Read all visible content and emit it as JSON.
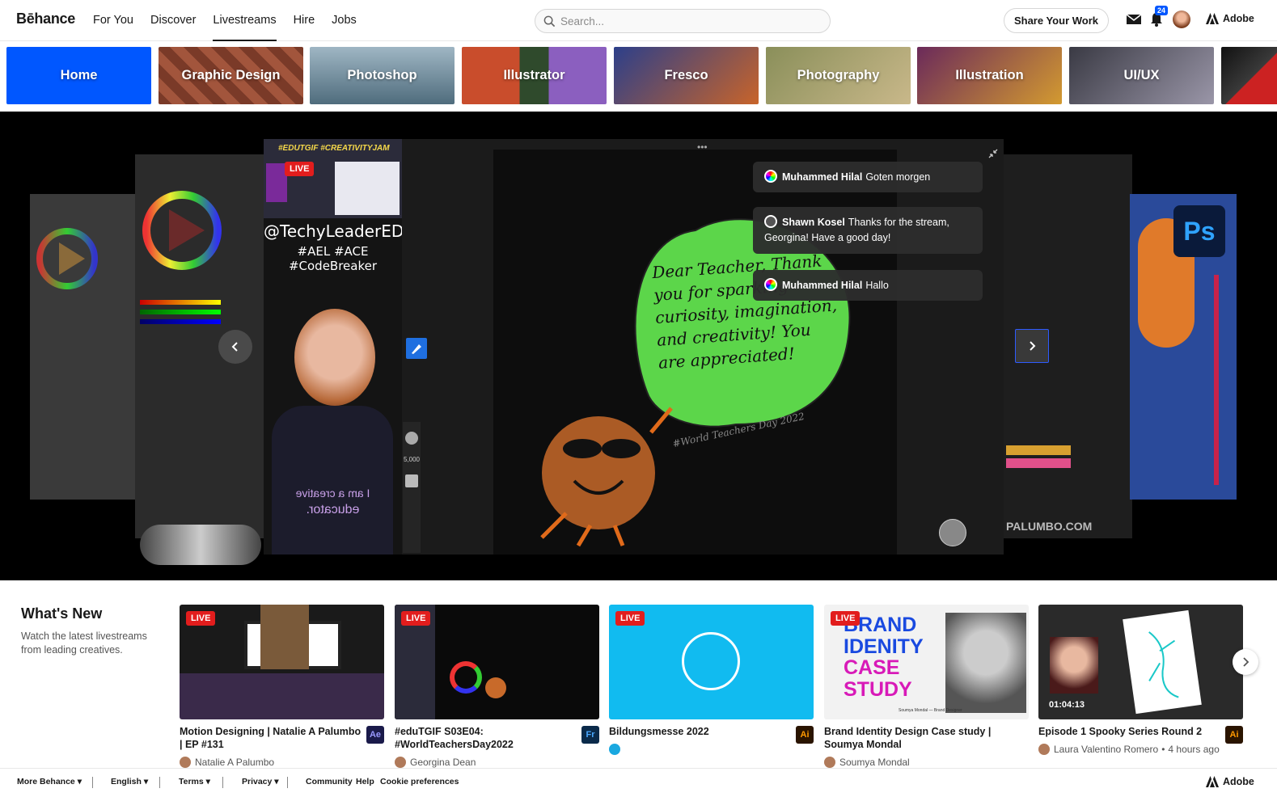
{
  "header": {
    "logo": "Bēhance",
    "nav": [
      "For You",
      "Discover",
      "Livestreams",
      "Hire",
      "Jobs"
    ],
    "active_nav": "Livestreams",
    "search_placeholder": "Search...",
    "share_label": "Share Your Work",
    "notification_count": "24",
    "adobe_label": "Adobe"
  },
  "categories": [
    "Home",
    "Graphic Design",
    "Photoshop",
    "Illustrator",
    "Fresco",
    "Photography",
    "Illustration",
    "UI/UX"
  ],
  "stream": {
    "live_label": "LIVE",
    "cam_hashtags_top": "#EDUTGIF #CREATIVITYJAM",
    "cam_handle": "@TechyLeaderEDU",
    "cam_tags": "#AEL #ACE #CodeBreaker",
    "cam_shirt_text_1": "I am a creative",
    "cam_shirt_text_2": "educator.",
    "canvas_text": "Dear Teacher, Thank you for sparking curiosity, imagination, and creativity! You are appreciated!",
    "canvas_hashtag": "#World Teachers Day 2022",
    "brush_size": "5,000",
    "side_right_text": "PALUMBO.COM",
    "ps_label": "Ps",
    "chat": [
      {
        "user": "Muhammed Hilal",
        "message": "Goten morgen"
      },
      {
        "user": "Shawn Kosel",
        "message": "Thanks for the stream, Georgina! Have a good day!"
      },
      {
        "user": "Muhammed Hilal",
        "message": "Hallo"
      }
    ]
  },
  "whats_new": {
    "title": "What's New",
    "description": "Watch the latest livestreams from leading creatives.",
    "cards": [
      {
        "title": "Motion Designing | Natalie A Palumbo | EP #131",
        "author": "Natalie A Palumbo",
        "app": "Ae",
        "live": "LIVE",
        "meta": ""
      },
      {
        "title": "#eduTGIF S03E04: #WorldTeachersDay2022",
        "author": "Georgina Dean",
        "app": "Fr",
        "live": "LIVE",
        "meta": ""
      },
      {
        "title": "Bildungsmesse 2022",
        "author": "",
        "app": "Ai",
        "live": "LIVE",
        "meta": ""
      },
      {
        "title": "Brand Identity Design Case study | Soumya Mondal",
        "author": "Soumya Mondal",
        "app": "",
        "live": "LIVE",
        "meta": ""
      },
      {
        "title": "Episode 1 Spooky Series Round 2",
        "author": "Laura Valentino Romero",
        "app": "Ai",
        "live": "",
        "meta": "4 hours ago",
        "duration": "01:04:13"
      }
    ],
    "brand_card_lines": [
      "BRAND",
      "IDENITY",
      "CASE",
      "STUDY"
    ],
    "brand_card_footer": "Soumya Mondal — Brand Designer"
  },
  "footer": {
    "items": [
      "More Behance",
      "English",
      "Terms",
      "Privacy",
      "Community",
      "Help",
      "Cookie preferences"
    ],
    "adobe_label": "Adobe"
  },
  "colors": {
    "accent_blue": "#0057ff",
    "live_red": "#e21d1d",
    "apple_green": "#5cd64a"
  }
}
